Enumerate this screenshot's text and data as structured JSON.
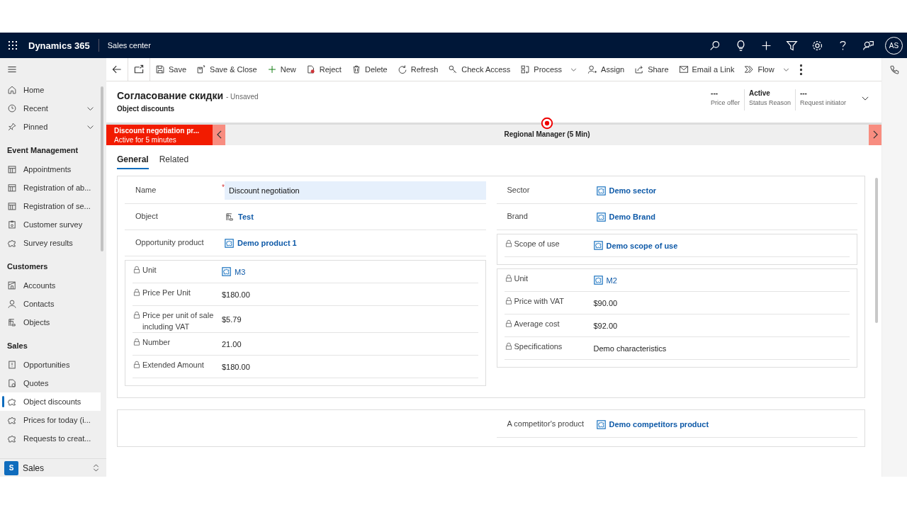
{
  "app_bar": {
    "app_name": "Dynamics 365",
    "area": "Sales center",
    "avatar": "AS"
  },
  "sidebar": {
    "sections": [
      {
        "items": [
          {
            "label": "Home",
            "kind": "home",
            "selected": false
          },
          {
            "label": "Recent",
            "kind": "clock",
            "selected": false,
            "expanded": false
          },
          {
            "label": "Pinned",
            "kind": "pin",
            "selected": false,
            "expanded": false
          }
        ]
      },
      {
        "title": "Event Management",
        "items": [
          {
            "label": "Appointments",
            "kind": "calendar",
            "selected": false
          },
          {
            "label": "Registration of ab...",
            "kind": "calendar",
            "selected": false
          },
          {
            "label": "Registration of se...",
            "kind": "calendar",
            "selected": false
          },
          {
            "label": "Customer survey",
            "kind": "survey",
            "selected": false
          },
          {
            "label": "Survey results",
            "kind": "puzzle",
            "selected": false
          }
        ]
      },
      {
        "title": "Customers",
        "items": [
          {
            "label": "Accounts",
            "kind": "account",
            "selected": false
          },
          {
            "label": "Contacts",
            "kind": "person",
            "selected": false
          },
          {
            "label": "Objects",
            "kind": "crane",
            "selected": false
          }
        ]
      },
      {
        "title": "Sales",
        "items": [
          {
            "label": "Opportunities",
            "kind": "opportunity",
            "selected": false
          },
          {
            "label": "Quotes",
            "kind": "quote",
            "selected": false
          },
          {
            "label": "Object discounts",
            "kind": "puzzle",
            "selected": true
          },
          {
            "label": "Prices for today (i...",
            "kind": "puzzle",
            "selected": false
          },
          {
            "label": "Requests to creat...",
            "kind": "puzzle",
            "selected": false
          }
        ]
      }
    ],
    "area_switcher": {
      "badge": "S",
      "label": "Sales"
    }
  },
  "command_bar": [
    {
      "label": "Save",
      "kind": "save"
    },
    {
      "label": "Save & Close",
      "kind": "saveclose"
    },
    {
      "label": "New",
      "kind": "plus"
    },
    {
      "label": "Reject",
      "kind": "reject"
    },
    {
      "label": "Delete",
      "kind": "trash"
    },
    {
      "label": "Refresh",
      "kind": "refresh"
    },
    {
      "label": "Check Access",
      "kind": "key"
    },
    {
      "label": "Process",
      "kind": "process",
      "dropdown": true
    },
    {
      "label": "Assign",
      "kind": "assign"
    },
    {
      "label": "Share",
      "kind": "share"
    },
    {
      "label": "Email a Link",
      "kind": "mail"
    },
    {
      "label": "Flow",
      "kind": "flow",
      "dropdown": true
    }
  ],
  "record": {
    "title": "Согласование скидки",
    "save_state": "- Unsaved",
    "entity": "Object discounts",
    "header_fields": [
      {
        "value": "---",
        "label": "Price offer"
      },
      {
        "value": "Active",
        "label": "Status Reason"
      },
      {
        "value": "---",
        "label": "Request initiator"
      }
    ]
  },
  "process_bar": {
    "active_stage": {
      "name": "Discount negotiation pr...",
      "duration": "Active for 5 minutes"
    },
    "stage": "Regional Manager  (5 Min)"
  },
  "tabs": [
    {
      "label": "General",
      "selected": true
    },
    {
      "label": "Related",
      "selected": false
    }
  ],
  "sections": [
    {
      "columns": [
        {
          "blocks": [
            {
              "boxed": false,
              "fields": [
                {
                  "label": "Name",
                  "value": "Discount negotiation",
                  "kind": "input",
                  "required_mark": "*",
                  "locked": false
                },
                {
                  "label": "Object",
                  "value": "Test",
                  "kind": "record",
                  "locked": false
                },
                {
                  "label": "Opportunity product",
                  "value": "Demo product 1",
                  "kind": "lookup",
                  "locked": false
                }
              ]
            },
            {
              "boxed": true,
              "fields": [
                {
                  "label": "Unit",
                  "value": "M3",
                  "kind": "lookup-plain",
                  "locked": true
                },
                {
                  "label": "Price Per Unit",
                  "value": "$180.00",
                  "kind": "text",
                  "locked": true
                },
                {
                  "label": "Price per unit of sale including VAT",
                  "value": "$5.79",
                  "kind": "text",
                  "locked": true
                },
                {
                  "label": "Number",
                  "value": "21.00",
                  "kind": "text",
                  "locked": true
                },
                {
                  "label": "Extended Amount",
                  "value": "$180.00",
                  "kind": "text",
                  "locked": true
                }
              ]
            }
          ]
        },
        {
          "blocks": [
            {
              "boxed": false,
              "fields": [
                {
                  "label": "Sector",
                  "value": "Demo sector",
                  "kind": "lookup",
                  "locked": false
                },
                {
                  "label": "Brand",
                  "value": "Demo Brand",
                  "kind": "lookup",
                  "locked": false
                }
              ]
            },
            {
              "boxed": true,
              "fields": [
                {
                  "label": "Scope of use",
                  "value": "Demo scope of use",
                  "kind": "lookup",
                  "locked": true
                }
              ]
            },
            {
              "boxed": true,
              "fields": [
                {
                  "label": "Unit",
                  "value": "M2",
                  "kind": "lookup-plain",
                  "locked": true
                },
                {
                  "label": "Price with VAT",
                  "value": "$90.00",
                  "kind": "text",
                  "locked": true
                },
                {
                  "label": "Average cost",
                  "value": "$92.00",
                  "kind": "text",
                  "locked": true
                },
                {
                  "label": "Specifications",
                  "value": "Demo characteristics",
                  "kind": "text",
                  "locked": true
                }
              ]
            }
          ]
        }
      ]
    },
    {
      "columns": [
        {},
        {
          "blocks": [
            {
              "boxed": false,
              "fields": [
                {
                  "label": "A competitor's product",
                  "value": "Demo competitors product",
                  "kind": "lookup",
                  "locked": false
                }
              ]
            }
          ]
        }
      ]
    }
  ]
}
